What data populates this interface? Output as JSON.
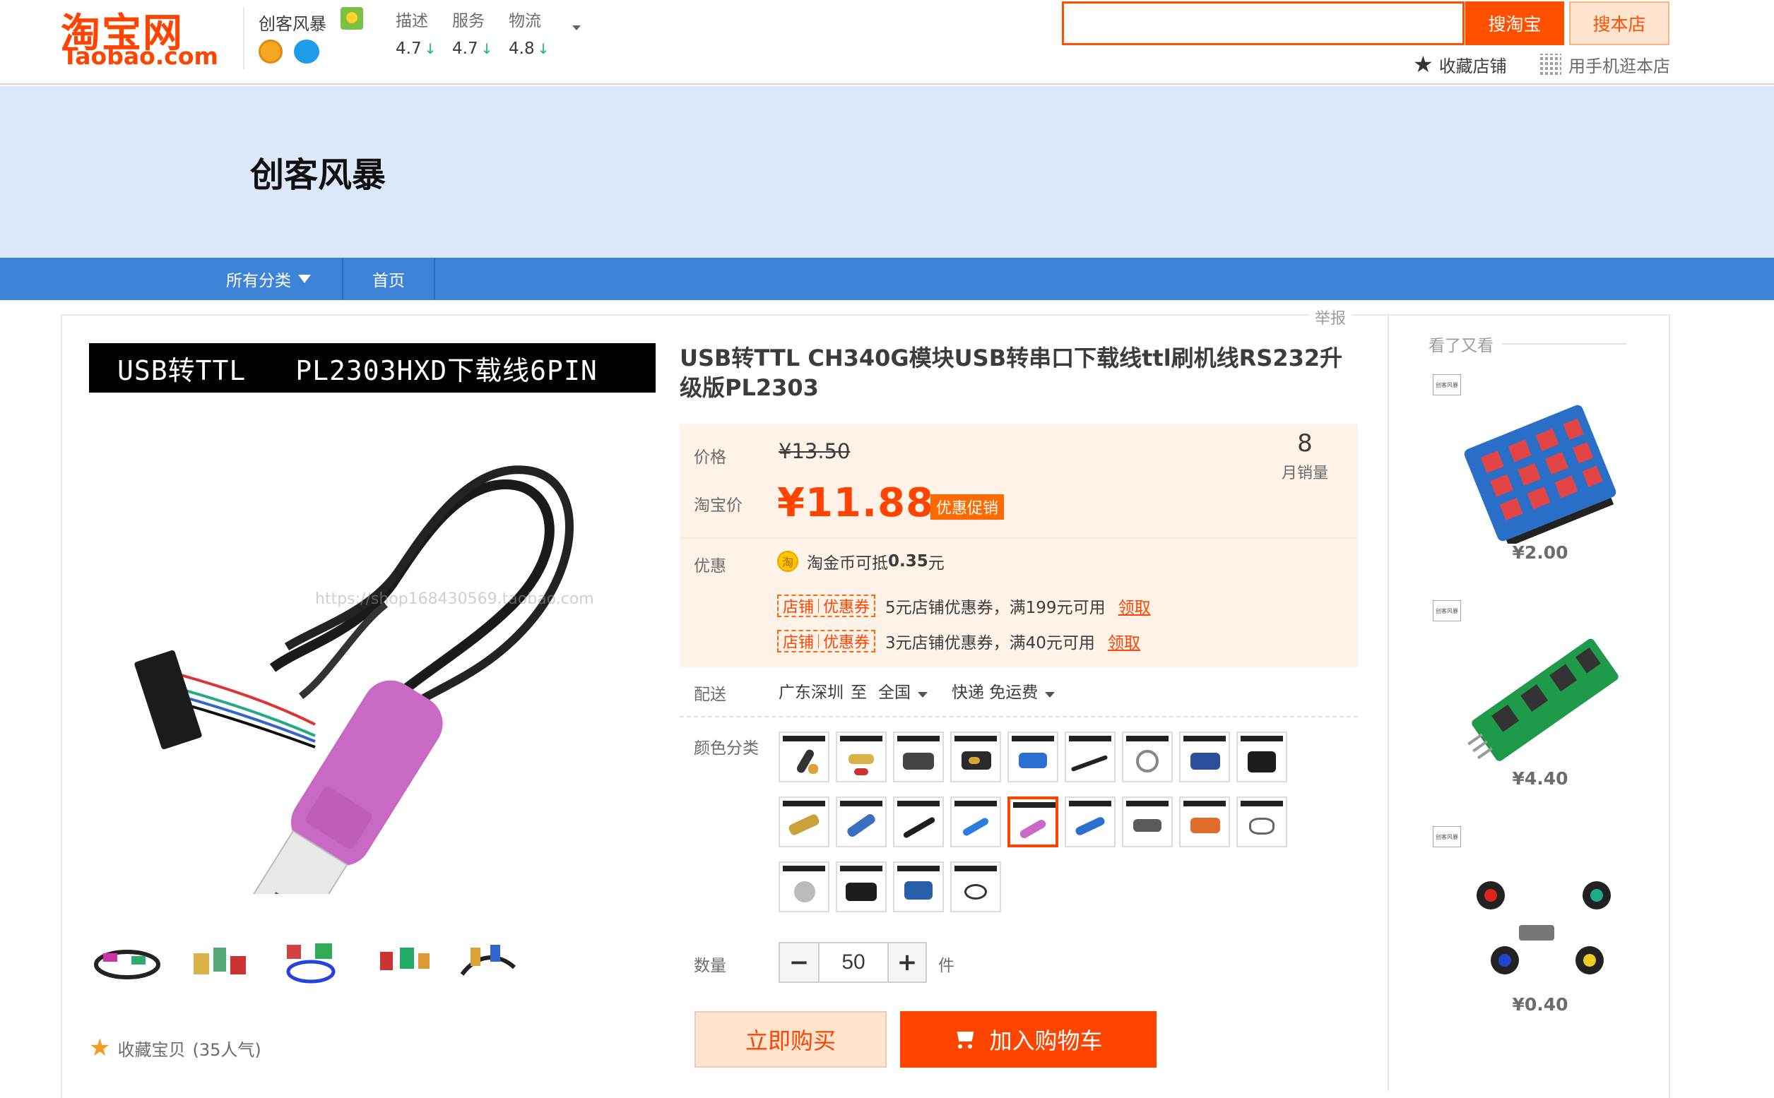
{
  "logo": {
    "cn": "淘宝网",
    "en": "Taobao.com"
  },
  "shop_mini": {
    "name": "创客风暴"
  },
  "ratings": [
    {
      "label": "描述",
      "value": "4.7"
    },
    {
      "label": "服务",
      "value": "4.7"
    },
    {
      "label": "物流",
      "value": "4.8"
    }
  ],
  "search": {
    "value": "",
    "placeholder": "",
    "taobao_button": "搜淘宝",
    "shop_button": "搜本店"
  },
  "header_links": {
    "fav_shop": "收藏店铺",
    "mobile_shop": "用手机逛本店"
  },
  "banner": {
    "title": "创客风暴"
  },
  "nav": {
    "all_categories": "所有分类",
    "home": "首页"
  },
  "report": "举报",
  "gallery": {
    "image_title_left": "USB转TTL",
    "image_title_right": "PL2303HXD下载线6PIN",
    "watermark": "https://shop168430569.taobao.com",
    "fav_item": "收藏宝贝",
    "fav_count": "(35人气)"
  },
  "product": {
    "title": "USB转TTL CH340G模块USB转串口下载线ttl刷机线RS232升级版PL2303",
    "price_label": "价格",
    "original_price": "¥13.50",
    "tb_price_label": "淘宝价",
    "tb_price": "¥11.88",
    "promo_tag": "优惠促销",
    "monthly_sales": "8",
    "monthly_sales_label": "月销量",
    "discount_label": "优惠",
    "coin_text": "淘金币可抵",
    "coin_value": "0.35",
    "coin_unit": "元",
    "coupons": [
      {
        "tag_left": "店铺",
        "tag_right": "优惠券",
        "text": "5元店铺优惠券，满199元可用",
        "action": "领取"
      },
      {
        "tag_left": "店铺",
        "tag_right": "优惠券",
        "text": "3元店铺优惠券，满40元可用",
        "action": "领取"
      }
    ],
    "shipping_label": "配送",
    "ship_from": "广东深圳",
    "ship_to_word": "至",
    "ship_to": "全国",
    "ship_fee": "快递 免运费",
    "color_label": "颜色分类",
    "quantity_label": "数量",
    "quantity_value": "50",
    "quantity_unit": "件",
    "buy_now": "立即购买",
    "add_to_cart": "加入购物车"
  },
  "recommend": {
    "title": "看了又看",
    "items": [
      {
        "price": "¥2.00"
      },
      {
        "price": "¥4.40"
      },
      {
        "price": "¥0.40"
      }
    ]
  },
  "colors": {
    "brand": "#ff4400",
    "banner_bg": "#dde9fb",
    "nav_bg": "#3d83d8",
    "price_panel_bg": "#fff2e8"
  }
}
